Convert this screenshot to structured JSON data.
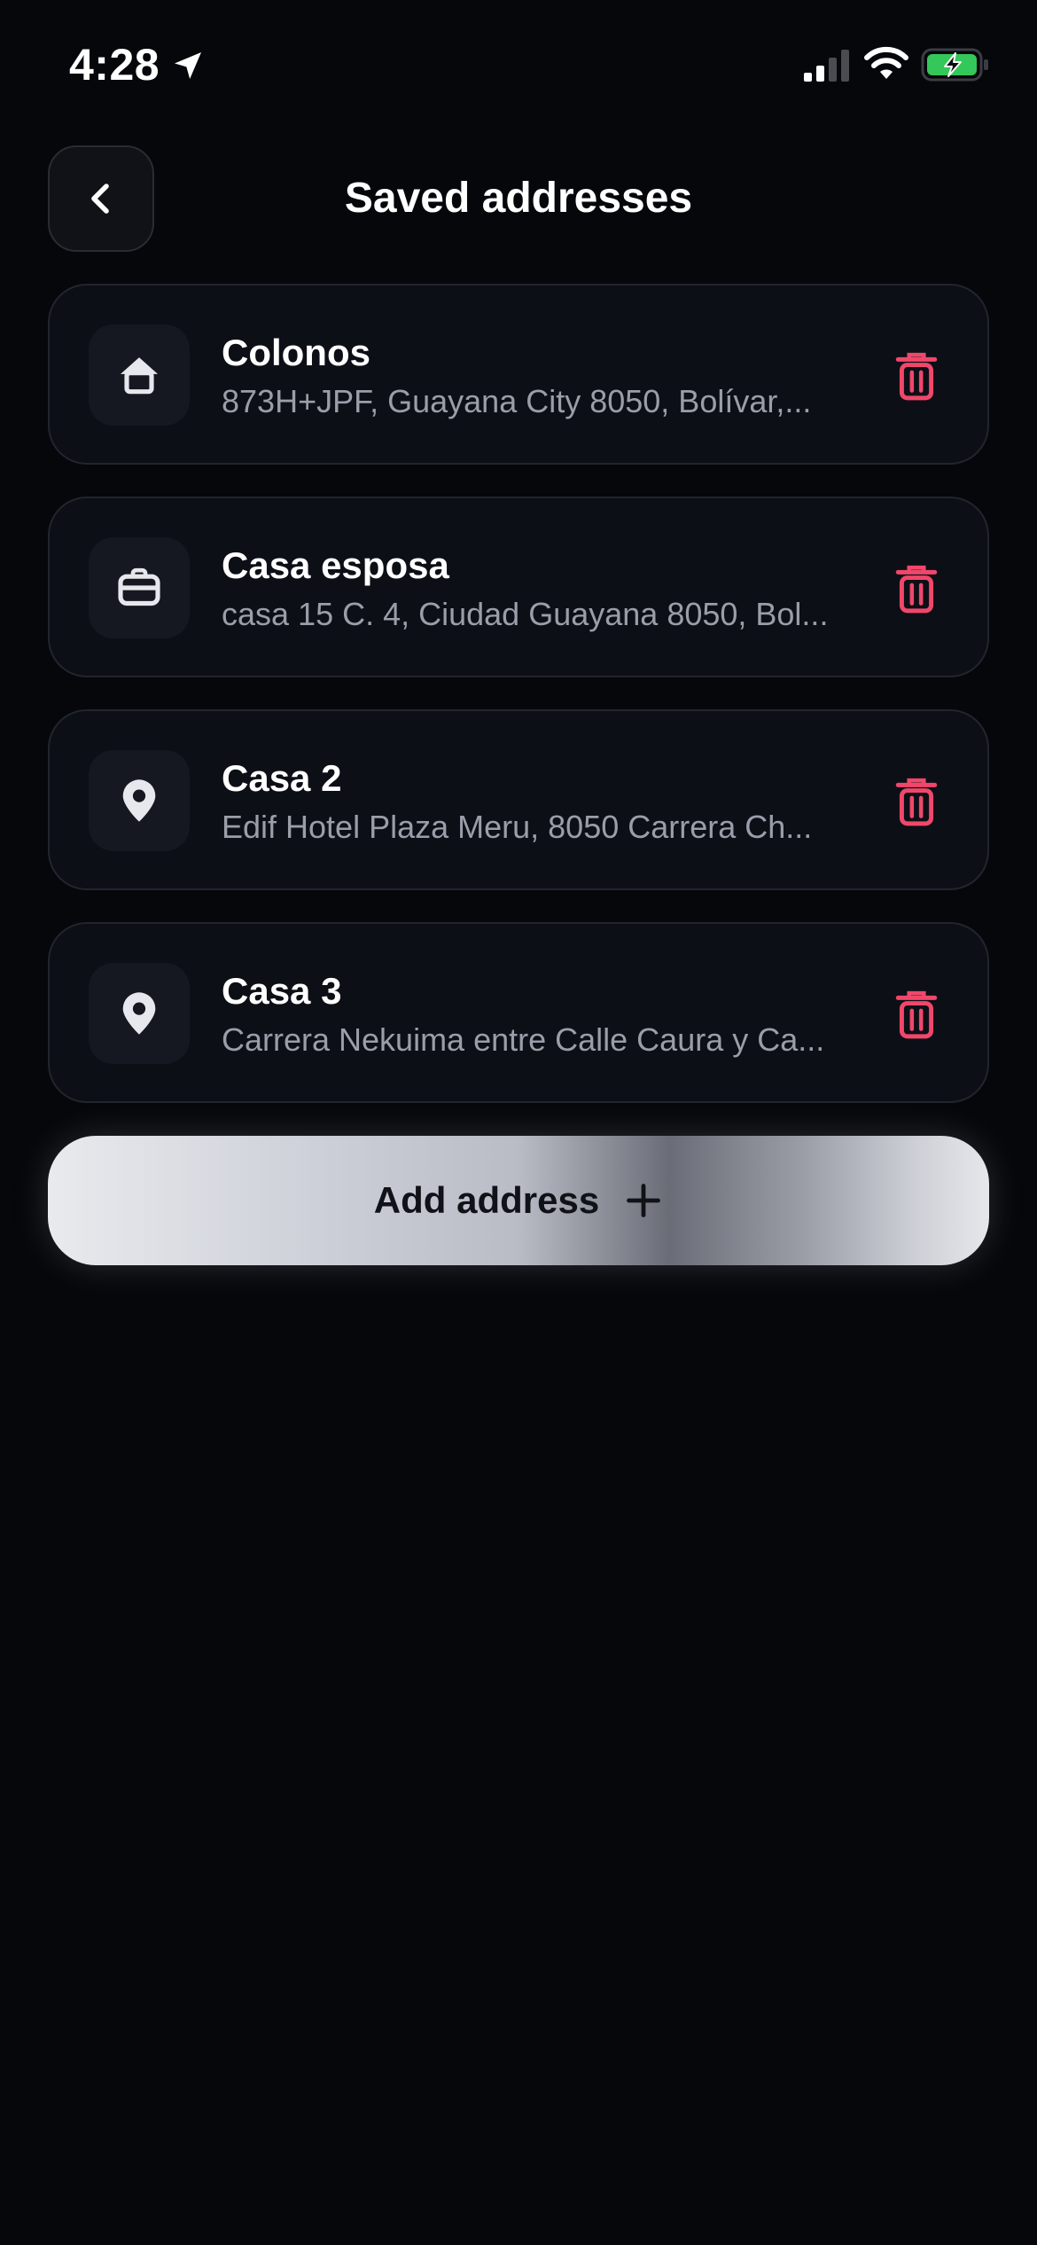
{
  "status_bar": {
    "time": "4:28",
    "battery_color": "#34c759"
  },
  "header": {
    "title": "Saved addresses",
    "back_icon": "chevron-left-icon"
  },
  "addresses": [
    {
      "name": "Colonos",
      "address": "873H+JPF, Guayana City 8050, Bolívar,...",
      "icon": "home-icon"
    },
    {
      "name": "Casa esposa",
      "address": "casa 15 C. 4, Ciudad Guayana 8050, Bol...",
      "icon": "briefcase-icon"
    },
    {
      "name": "Casa 2",
      "address": "Edif Hotel Plaza Meru, 8050 Carrera Ch...",
      "icon": "location-pin-icon"
    },
    {
      "name": "Casa 3",
      "address": "Carrera Nekuima entre Calle Caura y Ca...",
      "icon": "location-pin-icon"
    }
  ],
  "actions": {
    "add_label": "Add address",
    "delete_icon": "trash-icon"
  },
  "colors": {
    "background": "#06070b",
    "card": "#0d0f17",
    "delete": "#f0476a",
    "secondary_text": "#9a9ea8"
  }
}
